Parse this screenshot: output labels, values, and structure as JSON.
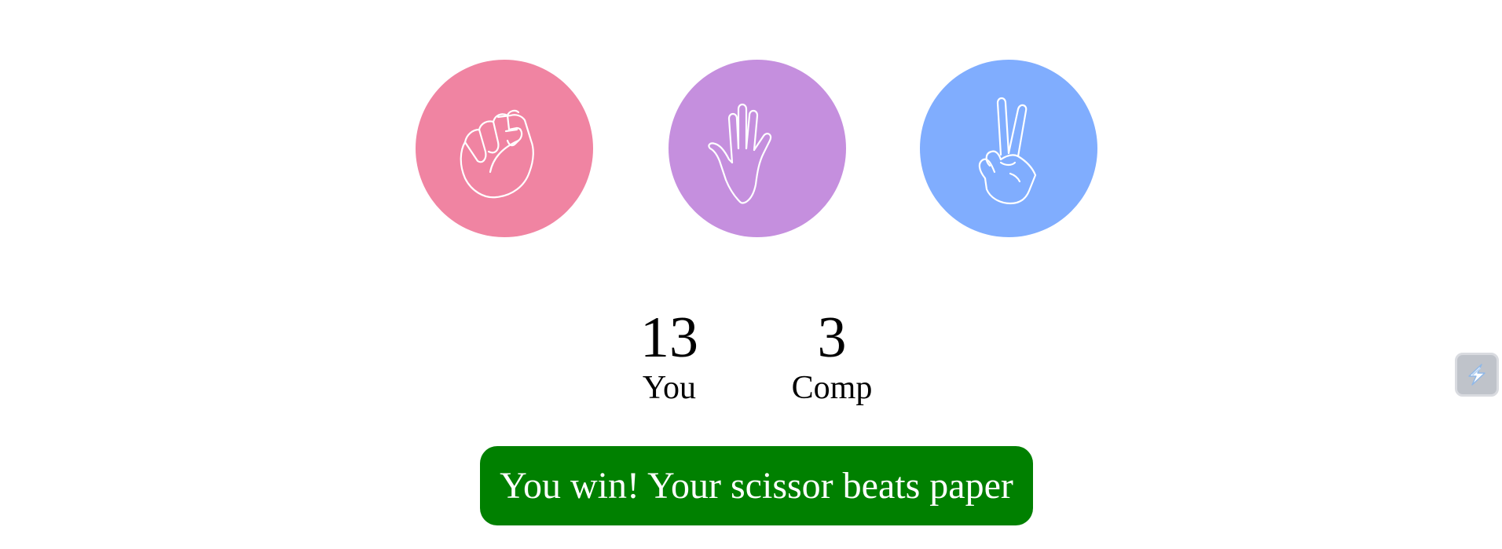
{
  "choices": [
    {
      "id": "rock",
      "icon": "fist-icon",
      "color": "#f084a2"
    },
    {
      "id": "paper",
      "icon": "open-hand-icon",
      "color": "#c58fde"
    },
    {
      "id": "scissor",
      "icon": "victory-hand-icon",
      "color": "#80adfe"
    }
  ],
  "scores": {
    "you": {
      "value": "13",
      "label": "You"
    },
    "comp": {
      "value": "3",
      "label": "Comp"
    }
  },
  "result": {
    "message": "You win! Your scissor beats paper",
    "color": "#008000"
  },
  "side_widget": {
    "icon": "lightning-bolt-icon"
  }
}
